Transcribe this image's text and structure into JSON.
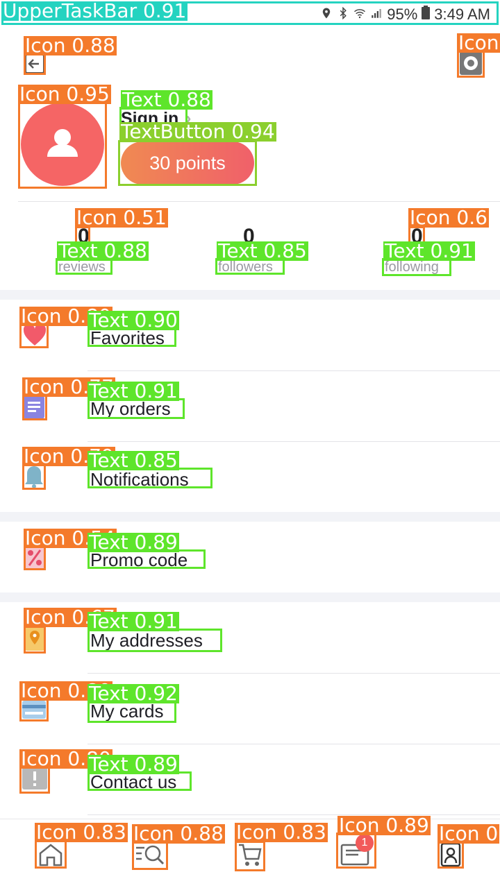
{
  "status_bar": {
    "battery": "95%",
    "time": "3:49 AM",
    "label": "UpperTaskBar 0.91"
  },
  "header": {
    "back_label": "Icon 0.88",
    "settings_label": "Icon"
  },
  "profile": {
    "avatar_label": "Icon 0.95",
    "sign_in": "Sign in",
    "sign_in_label": "Text 0.88",
    "points": "30 points",
    "points_label": "TextButton 0.94"
  },
  "stats": [
    {
      "value": "0",
      "label": "reviews",
      "icon_label": "Icon 0.51",
      "text_label": "Text 0.88"
    },
    {
      "value": "0",
      "label": "followers",
      "text_label": "Text 0.85"
    },
    {
      "value": "0",
      "label": "following",
      "icon_label": "Icon 0.6",
      "text_label": "Text 0.91"
    }
  ],
  "menu": [
    {
      "label": "Favorites",
      "icon": "heart-icon",
      "icon_label": "Icon 0.80",
      "text_label": "Text 0.90"
    },
    {
      "label": "My orders",
      "icon": "orders-icon",
      "icon_label": "Icon 0.77",
      "text_label": "Text 0.91"
    },
    {
      "label": "Notifications",
      "icon": "bell-icon",
      "icon_label": "Icon 0.79",
      "text_label": "Text 0.85"
    },
    {
      "label": "Promo code",
      "icon": "percent-icon",
      "icon_label": "Icon 0.54",
      "text_label": "Text 0.89"
    },
    {
      "label": "My addresses",
      "icon": "location-icon",
      "icon_label": "Icon 0.67",
      "text_label": "Text 0.91"
    },
    {
      "label": "My cards",
      "icon": "card-icon",
      "icon_label": "Icon 0.80",
      "text_label": "Text 0.92"
    },
    {
      "label": "Contact us",
      "icon": "alert-icon",
      "icon_label": "Icon 0.80",
      "text_label": "Text 0.89"
    }
  ],
  "tabbar": {
    "home_label": "Icon 0.83",
    "search_label": "Icon 0.88",
    "cart_label": "Icon 0.83",
    "feed_label": "Icon 0.89",
    "profile_label": "Icon 0",
    "badge": "1"
  },
  "colors": {
    "avatar": "#f56565",
    "accent_from": "#f08a52",
    "accent_to": "#f0606a",
    "icon_box": "#f47a2b",
    "text_box": "#5ee52b"
  }
}
